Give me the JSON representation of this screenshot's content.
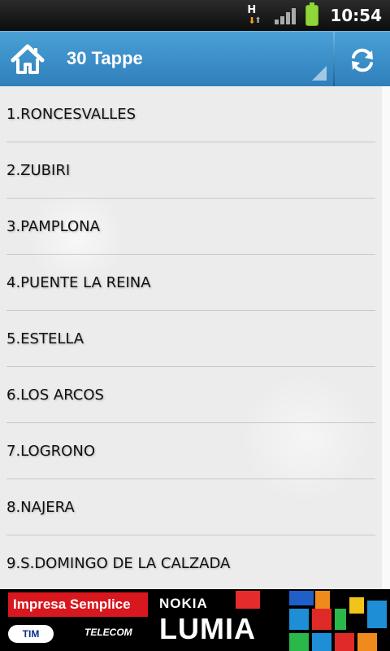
{
  "status_bar": {
    "network_type": "H",
    "time": "10:54",
    "icons": [
      "network-h-icon",
      "signal-icon",
      "battery-icon"
    ]
  },
  "action_bar": {
    "title": "30 Tappe",
    "home_icon": "home-icon",
    "refresh_icon": "refresh-icon"
  },
  "list": {
    "items": [
      "1.RONCESVALLES",
      "2.ZUBIRI",
      "3.PAMPLONA",
      "4.PUENTE LA REINA",
      "5.ESTELLA",
      "6.LOS ARCOS",
      "7.LOGRONO",
      "8.NAJERA",
      "9.S.DOMINGO DE LA CALZADA"
    ]
  },
  "ad": {
    "headline": "Impresa Semplice",
    "tim_label": "TIM",
    "telecom_label": "TELECOM",
    "brand": "NOKIA",
    "product": "LUMIA"
  },
  "colors": {
    "action_bar": "#3a8fc9",
    "list_background": "#ececec",
    "ad_red": "#d9171e"
  }
}
